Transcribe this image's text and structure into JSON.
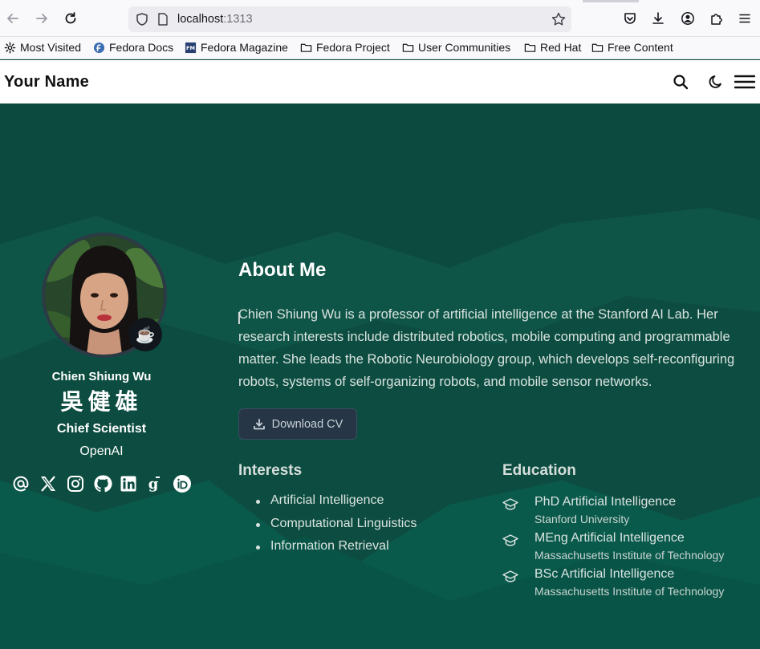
{
  "browser": {
    "url_host": "localhost",
    "url_port": ":1313",
    "bookmarks": [
      {
        "label": "Most Visited",
        "icon": "gear-icon"
      },
      {
        "label": "Fedora Docs",
        "icon": "fedora-icon"
      },
      {
        "label": "Fedora Magazine",
        "icon": "fm-icon"
      },
      {
        "label": "Fedora Project",
        "icon": "folder-icon"
      },
      {
        "label": "User Communities",
        "icon": "folder-icon"
      },
      {
        "label": "Red Hat",
        "icon": "folder-icon"
      },
      {
        "label": "Free Content",
        "icon": "folder-icon"
      }
    ]
  },
  "site": {
    "brand": "Your Name"
  },
  "profile": {
    "name": "Chien Shiung Wu",
    "name_cjk": "吳健雄",
    "role": "Chief Scientist",
    "organization": "OpenAI",
    "status_emoji": "☕",
    "social": [
      "email-icon",
      "x-icon",
      "instagram-icon",
      "github-icon",
      "linkedin-icon",
      "google-scholar-icon",
      "orcid-icon"
    ]
  },
  "about": {
    "title": "About Me",
    "body": "Chien Shiung Wu is a professor of artificial intelligence at the Stanford AI Lab. Her research interests include distributed robotics, mobile computing and programmable matter. She leads the Robotic Neurobiology group, which develops self-reconfiguring robots, systems of self-organizing robots, and mobile sensor networks.",
    "cv_label": "Download CV"
  },
  "interests": {
    "title": "Interests",
    "items": [
      "Artificial Intelligence",
      "Computational Linguistics",
      "Information Retrieval"
    ]
  },
  "education": {
    "title": "Education",
    "items": [
      {
        "degree": "PhD Artificial Intelligence",
        "institution": "Stanford University"
      },
      {
        "degree": "MEng Artificial Intelligence",
        "institution": "Massachusetts Institute of Technology"
      },
      {
        "degree": "BSc Artificial Intelligence",
        "institution": "Massachusetts Institute of Technology"
      }
    ]
  },
  "colors": {
    "hero_bg": "#0b4a40",
    "header_bg": "#ffffff",
    "button_bg": "#263646"
  }
}
